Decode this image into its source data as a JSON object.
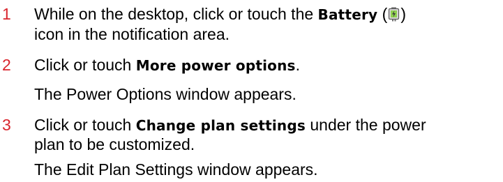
{
  "steps": [
    {
      "number": "1",
      "line1_pre": "While on the desktop, click or touch the ",
      "line1_bold": "Battery",
      "line1_open": " (",
      "icon": "battery-icon",
      "line1_close": ")",
      "line2": "icon in the notification area."
    },
    {
      "number": "2",
      "pre": "Click or touch ",
      "bold": "More power options",
      "post": ".",
      "result": "The Power Options window appears."
    },
    {
      "number": "3",
      "line1_pre": "Click or touch ",
      "line1_bold": "Change plan settings",
      "line1_post": " under the power",
      "line2": "plan to be customized.",
      "result": "The Edit Plan Settings window appears."
    }
  ],
  "colors": {
    "step_number": "#d9262e",
    "text": "#000000"
  }
}
